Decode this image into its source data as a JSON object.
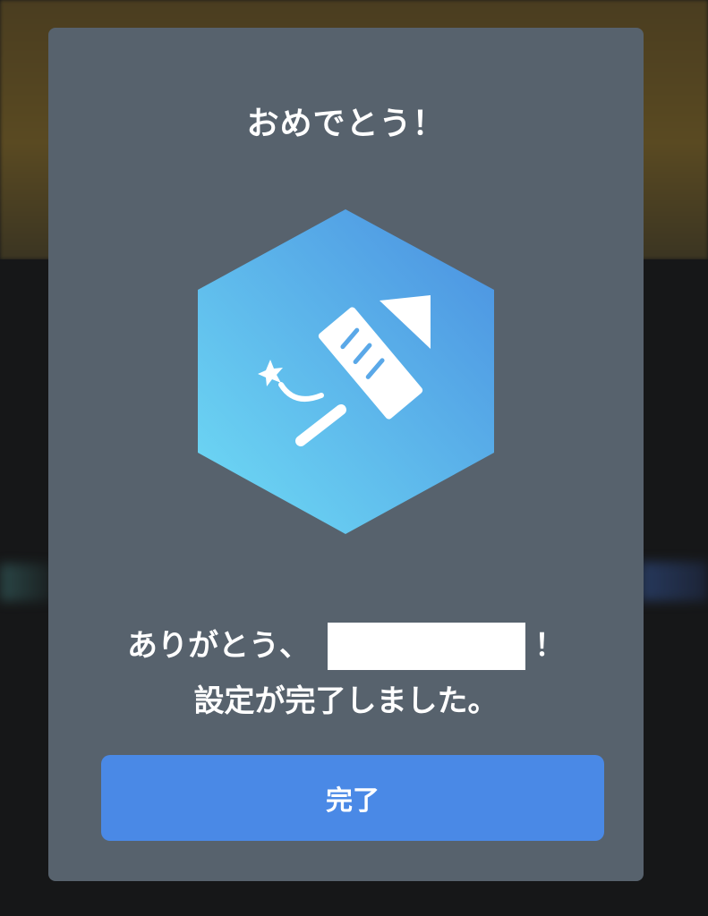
{
  "dialog": {
    "title": "おめでとう！",
    "icon": "rocket-firework-icon",
    "message_thanks": "ありがとう、",
    "message_exclaim": "！",
    "message_complete": "設定が完了しました。",
    "done_label": "完了"
  },
  "colors": {
    "dialog_bg": "#57626d",
    "button_bg": "#4a89e6",
    "hex_gradient_start": "#6fdcf5",
    "hex_gradient_end": "#4a8fe0"
  }
}
